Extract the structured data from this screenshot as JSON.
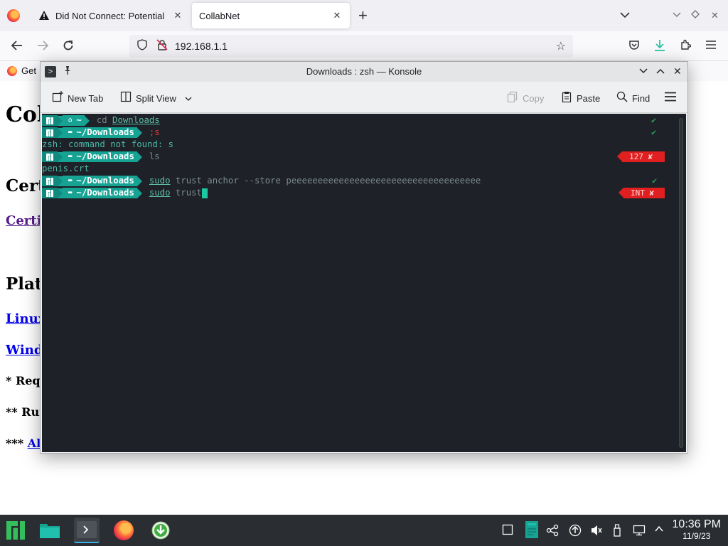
{
  "browser": {
    "tabs": [
      {
        "title": "Did Not Connect: Potential"
      },
      {
        "title": "CollabNet"
      }
    ],
    "url": "192.168.1.1",
    "bookmark": "Get"
  },
  "page": {
    "heading": "Col",
    "sections": [
      {
        "heading": "Cert"
      },
      {
        "heading": "Plat"
      }
    ],
    "links": {
      "certificate": "Certi",
      "linux": "Linux",
      "windows": "Wind"
    },
    "notes": {
      "required": "* Requ",
      "run": "** Run",
      "all_prefix": "*** ",
      "all_link": "Al"
    }
  },
  "konsole": {
    "title": "Downloads : zsh — Konsole",
    "toolbar": {
      "new_tab": "New Tab",
      "split_view": "Split View",
      "copy": "Copy",
      "paste": "Paste",
      "find": "Find"
    },
    "prompt": {
      "home": "~",
      "downloads": "~/Downloads"
    },
    "lines": {
      "l1_cmd": "cd",
      "l1_arg": "Downloads",
      "l1_status": "✔",
      "l2_cmd": ";s",
      "l2_status": "✔",
      "l3_out": "zsh: command not found: s",
      "l4_cmd": "ls",
      "l4_status": "127 ✘",
      "l5_out": "penis.crt",
      "l6_sudo": "sudo",
      "l6_rest": " trust anchor --store peeeeeeeeeeeeeeeeeeeeeeeeeeeeeeeeeeee",
      "l6_status": "✔",
      "l7_sudo": "sudo",
      "l7_rest": " trust",
      "l7_status": "INT ✘"
    }
  },
  "taskbar": {
    "time": "10:36 PM",
    "date": "11/9/23"
  },
  "colors": {
    "prompt_logo": "#0f8a7e",
    "prompt_dir": "#16a394",
    "terminal_bg": "#1e2127",
    "error_badge": "#e02020",
    "accent": "#3daee9"
  }
}
